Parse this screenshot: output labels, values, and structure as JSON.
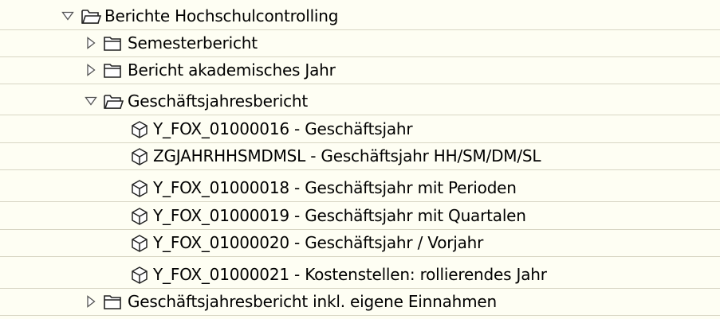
{
  "tree": {
    "root": {
      "label": "Berichte Hochschulcontrolling",
      "expanded": true,
      "icon": "folder-open-icon",
      "children": [
        {
          "label": "Semesterbericht",
          "expanded": false,
          "icon": "folder-closed-icon"
        },
        {
          "label": "Bericht akademisches Jahr",
          "expanded": false,
          "icon": "folder-closed-icon"
        },
        {
          "label": "Geschäftsjahresbericht",
          "expanded": true,
          "icon": "folder-open-icon",
          "children": [
            {
              "label": "Y_FOX_01000016 - Geschäftsjahr",
              "icon": "cube-icon"
            },
            {
              "label": "ZGJAHRHHSMDMSL - Geschäftsjahr HH/SM/DM/SL",
              "icon": "cube-icon"
            },
            {
              "label": "Y_FOX_01000018 - Geschäftsjahr mit Perioden",
              "icon": "cube-icon"
            },
            {
              "label": "Y_FOX_01000019 - Geschäftsjahr mit Quartalen",
              "icon": "cube-icon"
            },
            {
              "label": "Y_FOX_01000020 - Geschäftsjahr / Vorjahr",
              "icon": "cube-icon"
            },
            {
              "label": "Y_FOX_01000021 - Kostenstellen: rollierendes Jahr",
              "icon": "cube-icon"
            }
          ]
        },
        {
          "label": "Geschäftsjahresbericht inkl. eigene Einnahmen",
          "expanded": false,
          "icon": "folder-closed-icon"
        }
      ]
    }
  },
  "colors": {
    "background": "#fefef3",
    "row_divider": "#d8d6c4",
    "icon_stroke": "#222222",
    "folder_fill": "#ffffff"
  }
}
